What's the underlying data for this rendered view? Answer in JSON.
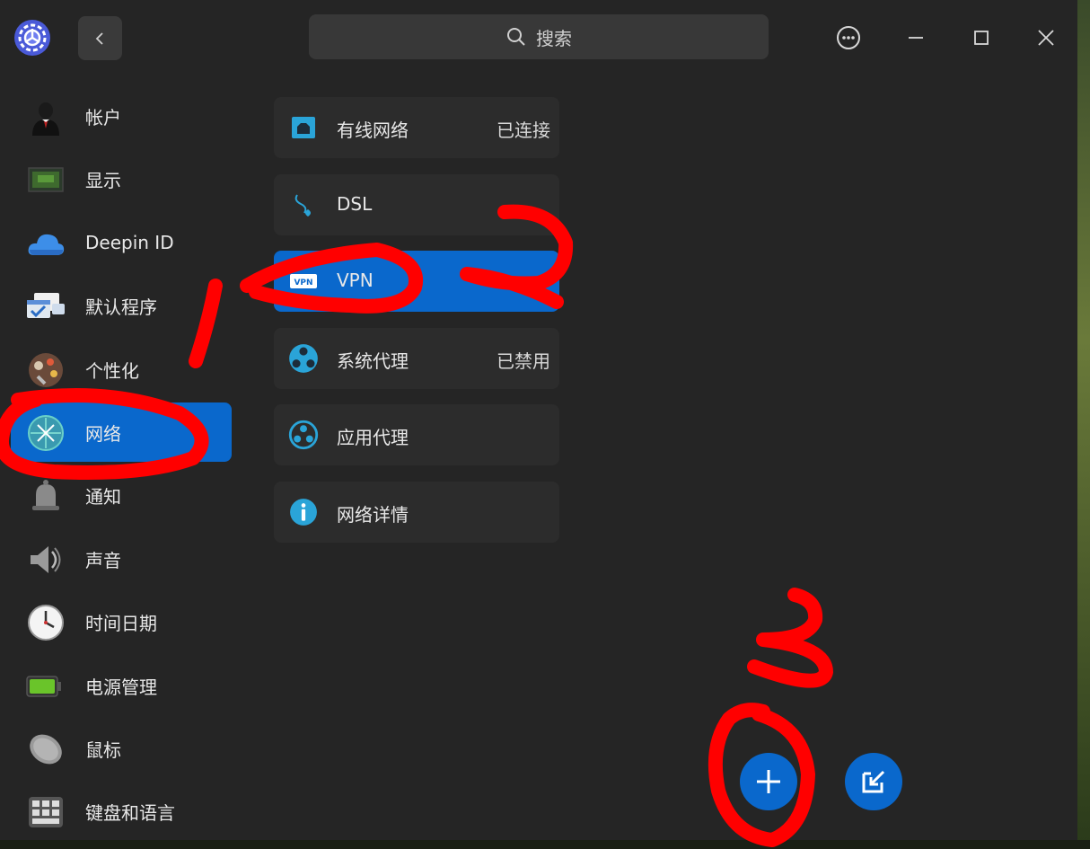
{
  "window": {
    "search": {
      "placeholder": "搜索"
    }
  },
  "sidebar": {
    "items": [
      {
        "label": "帐户",
        "icon": "account-icon"
      },
      {
        "label": "显示",
        "icon": "display-icon"
      },
      {
        "label": "Deepin ID",
        "icon": "cloud-icon"
      },
      {
        "label": "默认程序",
        "icon": "default-apps-icon"
      },
      {
        "label": "个性化",
        "icon": "personalization-icon"
      },
      {
        "label": "网络",
        "icon": "network-icon",
        "active": true
      },
      {
        "label": "通知",
        "icon": "bell-icon"
      },
      {
        "label": "声音",
        "icon": "speaker-icon"
      },
      {
        "label": "时间日期",
        "icon": "clock-icon"
      },
      {
        "label": "电源管理",
        "icon": "battery-icon"
      },
      {
        "label": "鼠标",
        "icon": "mouse-icon"
      },
      {
        "label": "键盘和语言",
        "icon": "keyboard-icon"
      }
    ]
  },
  "network": {
    "items": [
      {
        "label": "有线网络",
        "status": "已连接",
        "icon": "wired-network-icon"
      },
      {
        "label": "DSL",
        "status": "",
        "icon": "dsl-icon"
      },
      {
        "label": "VPN",
        "status": "",
        "icon": "vpn-icon",
        "active": true
      },
      {
        "label": "系统代理",
        "status": "已禁用",
        "icon": "system-proxy-icon"
      },
      {
        "label": "应用代理",
        "status": "",
        "icon": "app-proxy-icon"
      },
      {
        "label": "网络详情",
        "status": "",
        "icon": "info-icon"
      }
    ]
  },
  "colors": {
    "accent": "#0a68cc",
    "annotation": "#ff0000"
  }
}
